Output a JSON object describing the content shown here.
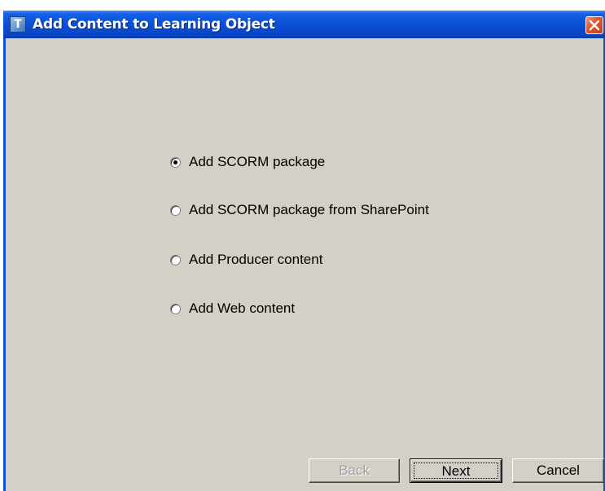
{
  "window": {
    "title": "Add Content to Learning Object",
    "app_icon_glyph": "T",
    "icons": {
      "app": "app-icon",
      "close": "close-icon"
    },
    "colors": {
      "titlebar": "#0a4fd6",
      "body": "#d4d0c8",
      "close_button": "#e2562f"
    }
  },
  "options": [
    {
      "label": "Add SCORM package",
      "selected": true
    },
    {
      "label": "Add SCORM package from SharePoint",
      "selected": false
    },
    {
      "label": "Add Producer content",
      "selected": false
    },
    {
      "label": "Add Web content",
      "selected": false
    }
  ],
  "buttons": {
    "back": {
      "label": "Back",
      "enabled": false
    },
    "next": {
      "label": "Next",
      "enabled": true,
      "default": true
    },
    "cancel": {
      "label": "Cancel",
      "enabled": true
    }
  }
}
